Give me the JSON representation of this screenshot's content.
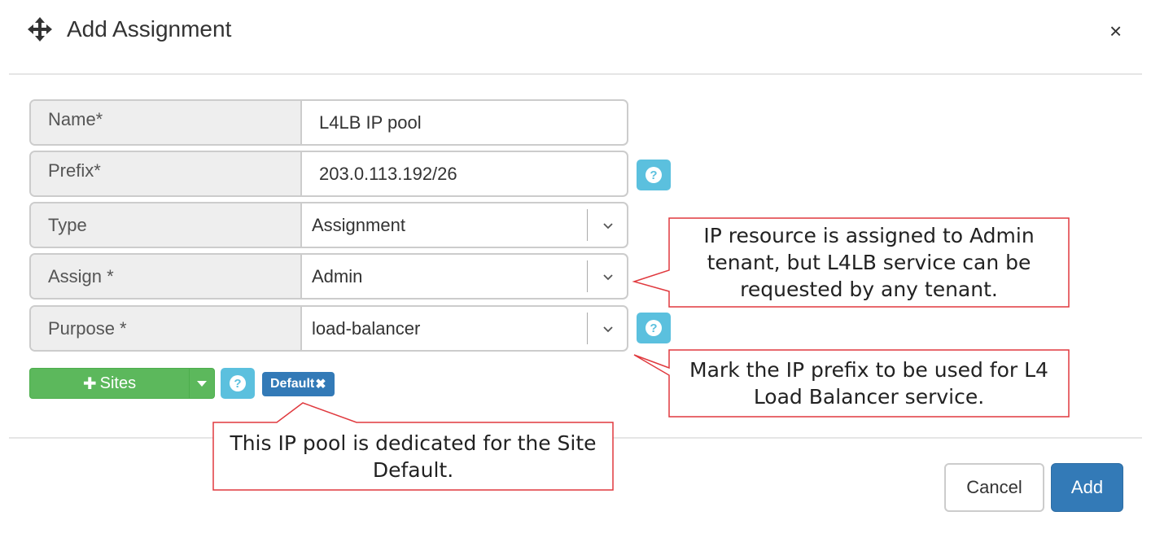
{
  "dialog": {
    "title": "Add Assignment",
    "close_symbol": "×",
    "icons": {
      "drag": "move-arrows-icon",
      "close": "close-icon"
    }
  },
  "form": {
    "name": {
      "label": "Name*",
      "value": "L4LB IP pool"
    },
    "prefix": {
      "label": "Prefix*",
      "value": "203.0.113.192/26"
    },
    "type": {
      "label": "Type",
      "selected": "Assignment"
    },
    "assign": {
      "label": "Assign *",
      "selected": "Admin"
    },
    "purpose": {
      "label": "Purpose *",
      "selected": "load-balancer"
    }
  },
  "sites": {
    "button_label": "Sites",
    "plus_symbol": "✚",
    "tag_label": "Default",
    "tag_remove_symbol": "✖"
  },
  "help_symbol": "?",
  "footer": {
    "cancel_label": "Cancel",
    "add_label": "Add"
  },
  "callouts": {
    "assign_note": "IP resource is assigned to Admin tenant, but L4LB service can be requested by any tenant.",
    "purpose_note": "Mark the IP prefix to be used for L4 Load Balancer service.",
    "site_note": "This IP pool is dedicated for the Site Default."
  },
  "colors": {
    "primary": "#337ab7",
    "success": "#5cb85c",
    "info": "#5bc0de",
    "callout_border": "#e0393e"
  }
}
